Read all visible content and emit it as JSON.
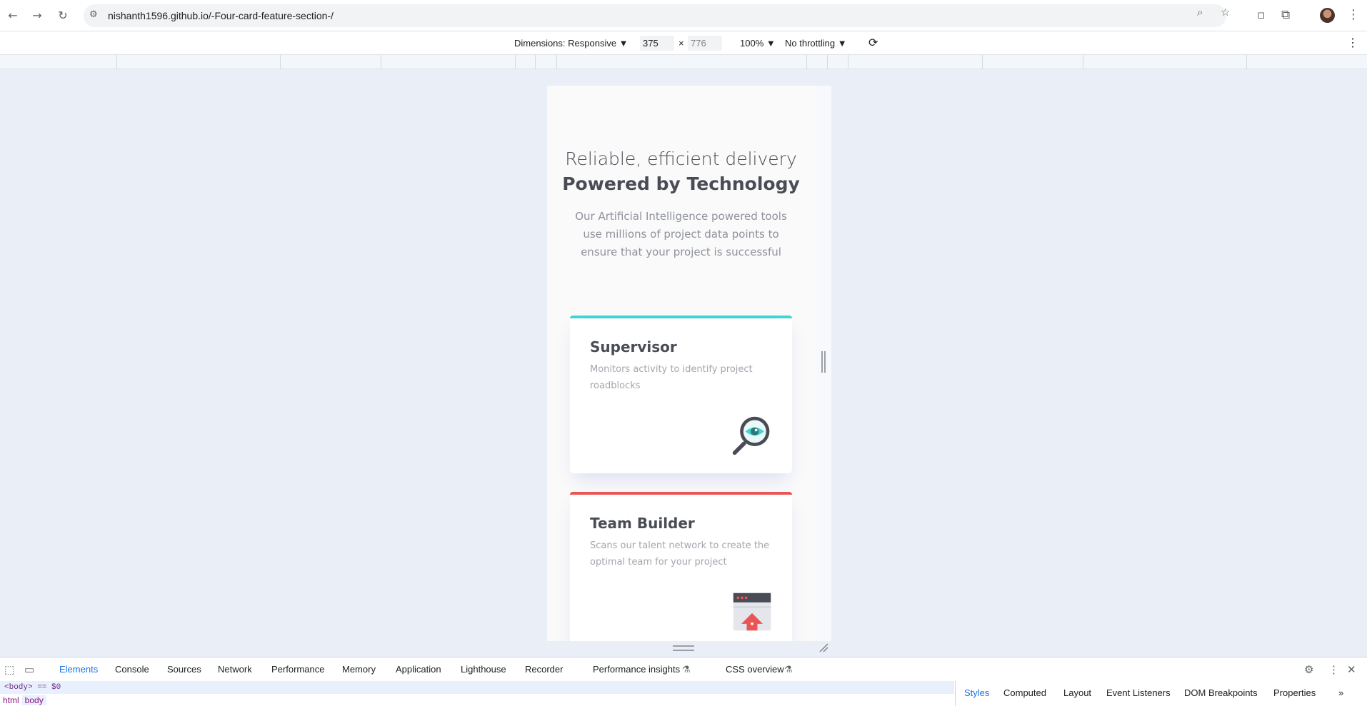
{
  "browser": {
    "url": "nishanth1596.github.io/-Four-card-feature-section-/",
    "back_icon": "←",
    "forward_icon": "→",
    "reload_icon": "↻"
  },
  "device_toolbar": {
    "dimensions_label": "Dimensions: Responsive ▼",
    "width_value": "375",
    "times": "×",
    "height_value": "776",
    "zoom": "100% ▼",
    "throttle": "No throttling ▼"
  },
  "page": {
    "title_line1": "Reliable, efficient delivery",
    "title_line2": "Powered by Technology",
    "description": "Our Artificial Intelligence powered tools use millions of project data points to ensure that your project is successful",
    "cards": [
      {
        "title": "Supervisor",
        "text": "Monitors activity to identify project roadblocks",
        "accent": "#44d3d2",
        "icon": "magnifier-eye-icon"
      },
      {
        "title": "Team Builder",
        "text": "Scans our talent network to create the optimal team for your project",
        "accent": "#ea5454",
        "icon": "upload-window-icon"
      }
    ]
  },
  "devtools": {
    "tabs": [
      "Elements",
      "Console",
      "Sources",
      "Network",
      "Performance",
      "Memory",
      "Application",
      "Lighthouse",
      "Recorder",
      "Performance insights",
      "CSS overview"
    ],
    "selected_node": "<body> == $0",
    "breadcrumbs": [
      "html",
      "body"
    ],
    "side_tabs": [
      "Styles",
      "Computed",
      "Layout",
      "Event Listeners",
      "DOM Breakpoints",
      "Properties"
    ]
  }
}
